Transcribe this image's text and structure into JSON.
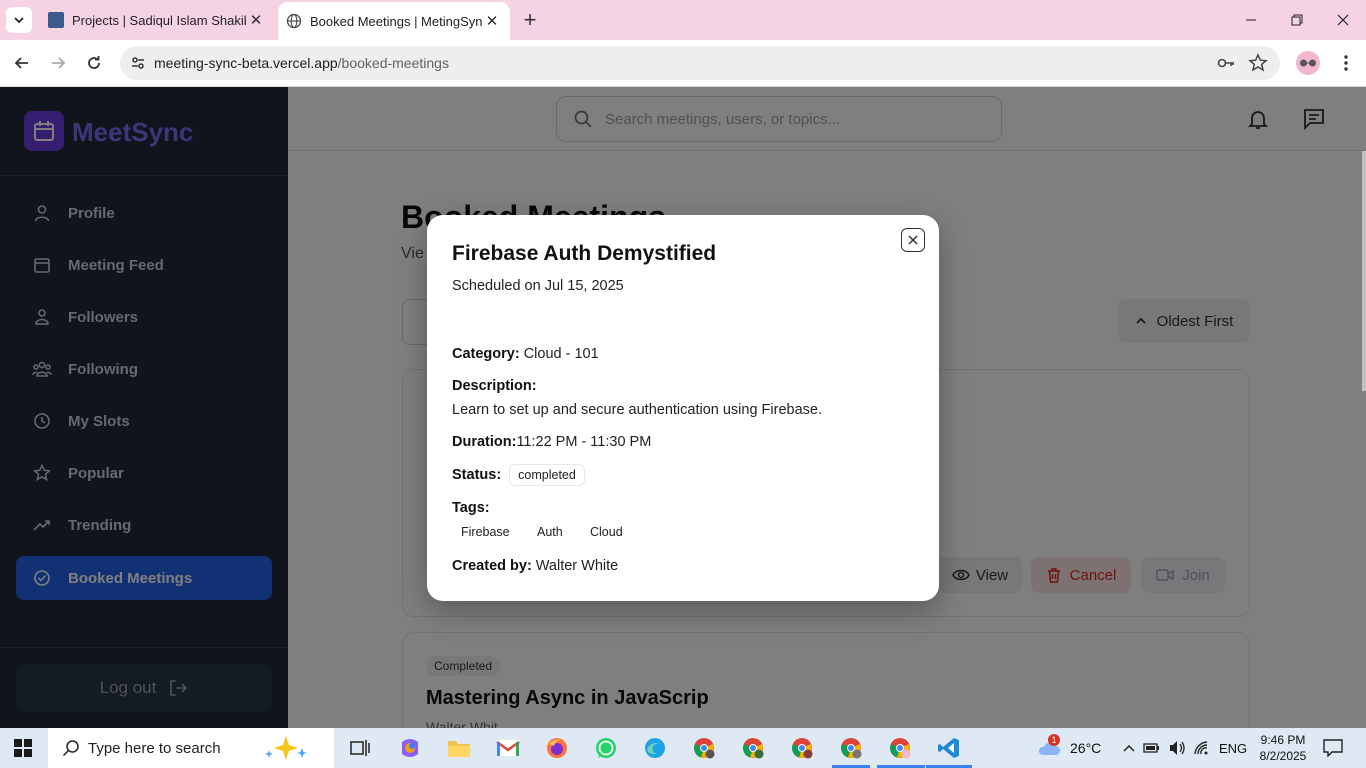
{
  "browser": {
    "tabs": [
      {
        "title": "Projects | Sadiqul Islam Shakib",
        "active": false
      },
      {
        "title": "Booked Meetings | MetingSync",
        "active": true
      }
    ],
    "url_host": "meeting-sync-beta.vercel.app",
    "url_path": "/booked-meetings",
    "close_glyph": "✕",
    "new_tab_glyph": "+"
  },
  "sidebar": {
    "logo_text": "MeetSync",
    "items": [
      {
        "label": "Profile",
        "icon": "user-icon"
      },
      {
        "label": "Meeting Feed",
        "icon": "calendar-icon"
      },
      {
        "label": "Followers",
        "icon": "users-icon"
      },
      {
        "label": "Following",
        "icon": "group-icon"
      },
      {
        "label": "My Slots",
        "icon": "clock-icon"
      },
      {
        "label": "Popular",
        "icon": "star-icon"
      },
      {
        "label": "Trending",
        "icon": "trending-icon"
      },
      {
        "label": "Booked Meetings",
        "icon": "check-circle-icon",
        "active": true
      }
    ],
    "logout_label": "Log out"
  },
  "header": {
    "search_placeholder": "Search meetings, users, or topics..."
  },
  "page": {
    "title": "Booked Meetings",
    "subtitle": "Vie",
    "sort_label": "Oldest First",
    "card_buttons": {
      "view": "View",
      "cancel": "Cancel",
      "join": "Join"
    },
    "second_card": {
      "badge": "Completed",
      "title": "Mastering Async in JavaScrip",
      "author": "Walter Whit"
    }
  },
  "modal": {
    "title": "Firebase Auth Demystified",
    "scheduled": "Scheduled on Jul 15, 2025",
    "category_label": "Category:",
    "category_value": "Cloud - 101",
    "description_label": "Description:",
    "description_value": "Learn to set up and secure authentication using Firebase.",
    "duration_label": "Duration:",
    "duration_value": "11:22 PM - 11:30 PM",
    "status_label": "Status:",
    "status_value": "completed",
    "tags_label": "Tags:",
    "tags": [
      "Firebase",
      "Auth",
      "Cloud"
    ],
    "created_label": "Created by:",
    "created_value": "Walter White"
  },
  "taskbar": {
    "search_placeholder": "Type here to search",
    "weather": "26°C",
    "weather_badge": "1",
    "language": "ENG",
    "time": "9:46 PM",
    "date": "8/2/2025"
  }
}
